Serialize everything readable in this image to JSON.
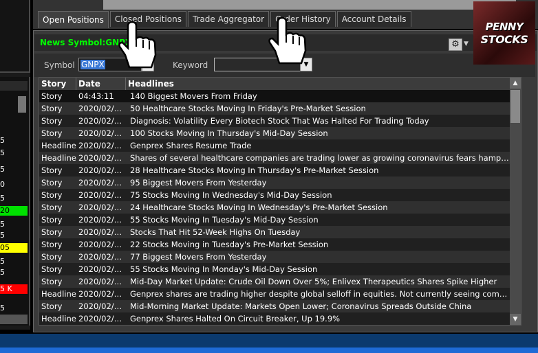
{
  "tabs": [
    {
      "label": "Open Positions",
      "active": true
    },
    {
      "label": "Closed Positions",
      "active": false
    },
    {
      "label": "Trade Aggregator",
      "active": false
    },
    {
      "label": "Order History",
      "active": false
    },
    {
      "label": "Account Details",
      "active": false
    }
  ],
  "window": {
    "title": "News Symbol:GNPX",
    "settings_icon": "gear-icon"
  },
  "filters": {
    "symbol_label": "Symbol",
    "symbol_value": "GNPX",
    "keyword_label": "Keyword",
    "keyword_value": ""
  },
  "table": {
    "columns": [
      "Story",
      "Date",
      "Headlines"
    ],
    "rows": [
      [
        "Story",
        "04:43:11",
        "140 Biggest Movers From Friday"
      ],
      [
        "Story",
        "2020/02/2...",
        "50 Healthcare Stocks Moving In Friday's Pre-Market Session"
      ],
      [
        "Story",
        "2020/02/2...",
        "Diagnosis: Volatility  Every Biotech Stock That Was Halted For Trading Today"
      ],
      [
        "Story",
        "2020/02/2...",
        "100 Stocks Moving In Thursday's Mid-Day Session"
      ],
      [
        "Headline",
        "2020/02/2...",
        "Genprex Shares Resume Trade"
      ],
      [
        "Headline",
        "2020/02/2...",
        "Shares of several healthcare companies are trading lower as growing coronavirus fears hamper economic ou..."
      ],
      [
        "Story",
        "2020/02/2...",
        "28 Healthcare Stocks Moving In Thursday's Pre-Market Session"
      ],
      [
        "Story",
        "2020/02/2...",
        "95 Biggest Movers From Yesterday"
      ],
      [
        "Story",
        "2020/02/2...",
        "75 Stocks Moving In Wednesday's Mid-Day Session"
      ],
      [
        "Story",
        "2020/02/2...",
        "24 Healthcare Stocks Moving In Wednesday's Pre-Market Session"
      ],
      [
        "Story",
        "2020/02/2...",
        "55 Stocks Moving In Tuesday's Mid-Day Session"
      ],
      [
        "Story",
        "2020/02/2...",
        "Stocks That Hit 52-Week Highs On Tuesday"
      ],
      [
        "Story",
        "2020/02/2...",
        "22 Stocks Moving in Tuesday's Pre-Market Session"
      ],
      [
        "Story",
        "2020/02/2...",
        "77 Biggest Movers From Yesterday"
      ],
      [
        "Story",
        "2020/02/2...",
        "55 Stocks Moving In Monday's Mid-Day Session"
      ],
      [
        "Story",
        "2020/02/2...",
        "Mid-Day Market Update: Crude Oil Down Over 5%; Enlivex Therapeutics Shares Spike Higher"
      ],
      [
        "Headline",
        "2020/02/2...",
        "Genprex shares are trading higher despite global selloff in equities. Not currently seeing company-specific ne..."
      ],
      [
        "Story",
        "2020/02/2...",
        "Mid-Morning Market Update: Markets Open Lower; Coronavirus Spreads Outside China"
      ],
      [
        "Headline",
        "2020/02/2...",
        "Genprex Shares Halted On Circuit Breaker, Up 19.9%"
      ]
    ]
  },
  "left_panel": {
    "values": [
      "5",
      "5",
      "5",
      "0",
      "5",
      "20",
      "5",
      "5",
      "05",
      "5",
      "5",
      "5 K",
      "5"
    ],
    "highlight_colors": {
      "green": "#00e000",
      "yellow": "#ffff00",
      "red": "#ff0000"
    }
  },
  "logo": {
    "line1": "PENNY",
    "line2": "STOCKS"
  },
  "colors": {
    "title_green": "#00ff00",
    "selection_blue": "#3a78d6",
    "bottom_blue": "#1e6bd6"
  }
}
